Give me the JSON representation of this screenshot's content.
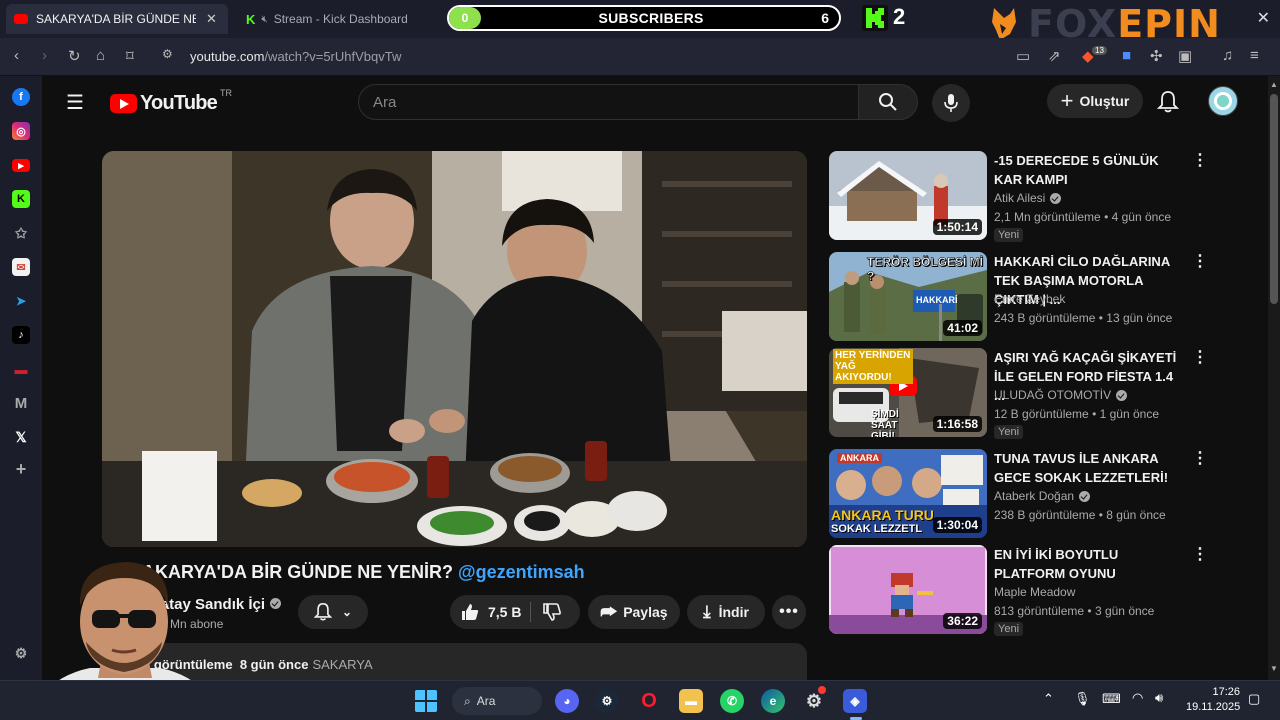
{
  "browser": {
    "tabs": [
      {
        "label": "SAKARYA'DA BİR GÜNDE NE YEN",
        "active": true
      },
      {
        "label": "Stream - Kick Dashboard",
        "active": false
      }
    ],
    "url_host": "youtube.com",
    "url_rest": "/watch?v=5rUhfVbqvTw",
    "brave_badge": "13"
  },
  "overlay": {
    "subs_pill": "0",
    "subs_label": "SUBSCRIBERS",
    "subs_count": "6",
    "kick_letter": "K",
    "kick_count": "2",
    "brand_left": "FOX",
    "brand_right": "EPIN"
  },
  "youtube": {
    "logo_word": "YouTube",
    "logo_country": "TR",
    "search_placeholder": "Ara",
    "create_label": "Oluştur",
    "video": {
      "title": "SAKARYA'DA BİR GÜNDE NE YENİR?",
      "hashtag": "@gezentimsah",
      "channel": "Hatay Sandık İçi",
      "subscribers": "1,8 Mn abone",
      "likes": "7,5 B",
      "share_label": "Paylaş",
      "download_label": "İndir",
      "views": "8 B görüntüleme",
      "age": "8 gün önce",
      "location_tag": "SAKARYA"
    },
    "recommended": [
      {
        "title": "-15 DERECEDE 5 GÜNLÜK KAR KAMPI",
        "channel": "Atik Ailesi",
        "verified": true,
        "views": "2,1 Mn görüntüleme",
        "age": "4 gün önce",
        "badge": "Yeni",
        "duration": "1:50:14",
        "thumb_colors": [
          "#c9d2dc",
          "#e8ecf0",
          "#8a96a4"
        ]
      },
      {
        "title": "HAKKARİ CİLO DAĞLARINA TEK BAŞIMA MOTORLA ÇIKTIM | ...",
        "channel": "Emre Zeybek",
        "verified": false,
        "views": "243 B görüntüleme",
        "age": "13 gün önce",
        "badge": "",
        "duration": "41:02",
        "thumb_colors": [
          "#7aa5c9",
          "#6a7f52",
          "#3f4d31"
        ],
        "thumb_text": "TERÖR BÖLGESİ Mİ ?",
        "thumb_sign": "HAKKARİ"
      },
      {
        "title": "AŞIRI YAĞ KAÇAĞI ŞİKAYETİ İLE GELEN FORD FİESTA 1.4 ...",
        "channel": "ULUDAĞ OTOMOTİV",
        "verified": true,
        "views": "12 B görüntüleme",
        "age": "1 gün önce",
        "badge": "Yeni",
        "duration": "1:16:58",
        "thumb_colors": [
          "#5f5a52",
          "#8d8478",
          "#2e2b27"
        ],
        "thumb_text": "HER YERİNDEN YAĞ AKIYORDU!",
        "thumb_text2": "ŞİMDİ SAAT GİBİ!"
      },
      {
        "title": "TUNA TAVUS İLE ANKARA GECE SOKAK LEZZETLERİ!",
        "channel": "Ataberk Doğan",
        "verified": true,
        "views": "238 B görüntüleme",
        "age": "8 gün önce",
        "badge": "",
        "duration": "1:30:04",
        "thumb_colors": [
          "#4a78c8",
          "#2b4d9c",
          "#f2b632"
        ],
        "thumb_tag": "ANKARA",
        "thumb_text": "ANKARA TURU",
        "thumb_text2": "SOKAK LEZZETL"
      },
      {
        "title": "EN İYİ İKİ BOYUTLU PLATFORM OYUNU",
        "channel": "Maple Meadow",
        "verified": false,
        "views": "813 görüntüleme",
        "age": "3 gün önce",
        "badge": "Yeni",
        "duration": "36:22",
        "thumb_colors": [
          "#e6a3e6",
          "#c88ad6",
          "#6b3a7a"
        ]
      }
    ]
  },
  "taskbar": {
    "search_label": "Ara",
    "time": "17:26",
    "date": "19.11.2025"
  }
}
